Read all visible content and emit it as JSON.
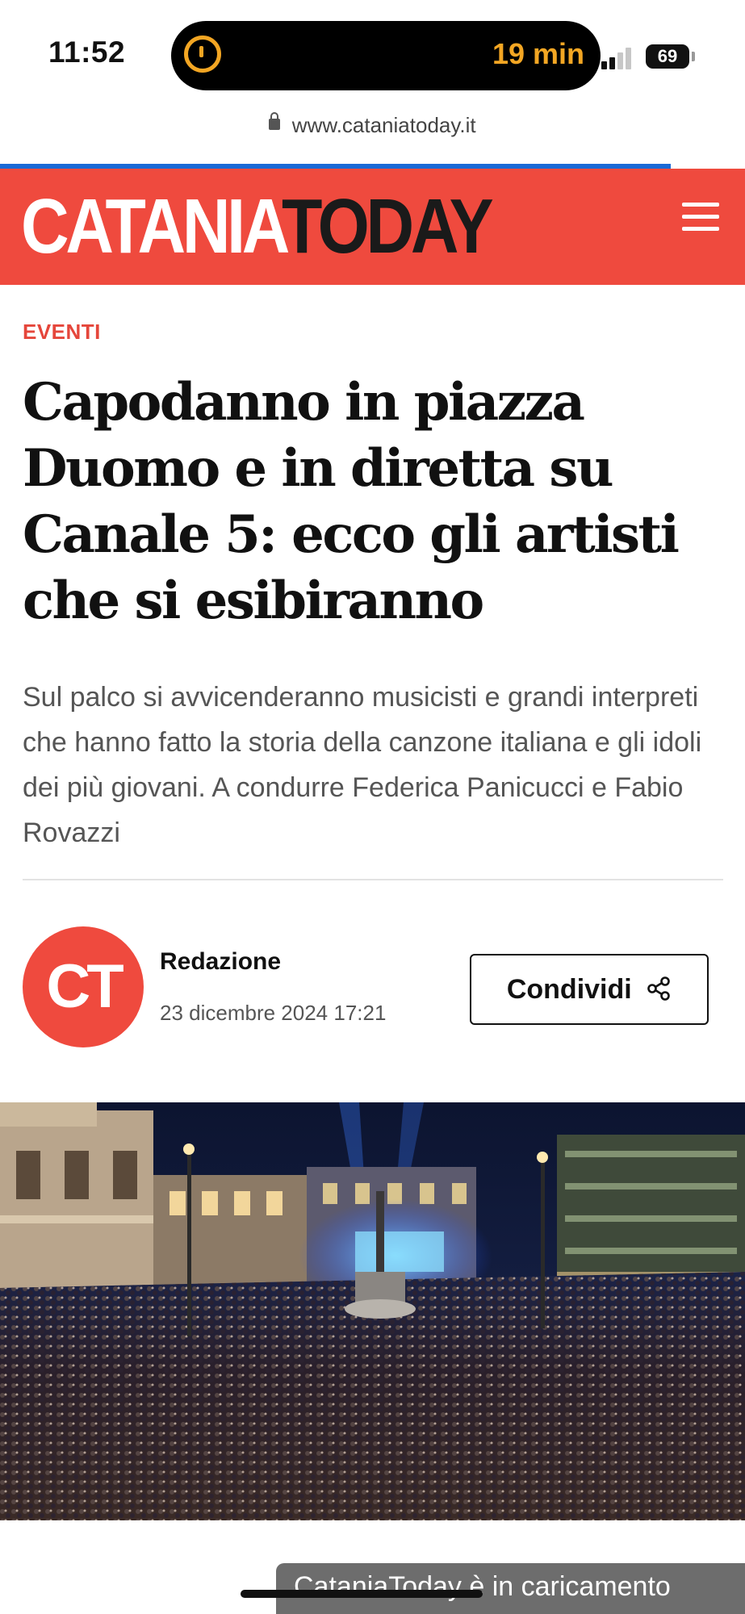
{
  "status_bar": {
    "time": "11:52",
    "activity_text": "19 min",
    "battery": "69"
  },
  "browser": {
    "url": "www.cataniatoday.it",
    "load_progress": 0.9
  },
  "site": {
    "logo_part1": "CATANIA",
    "logo_part2": "TODAY",
    "brand_color": "#ef4a3e"
  },
  "article": {
    "category": "EVENTI",
    "headline": "Capodanno in piazza Duomo e in diretta su Canale 5: ecco gli artisti che si esibiranno",
    "summary": "Sul palco si avvicenderanno musicisti e grandi interpreti che hanno fatto la storia della canzone italiana e gli idoli dei più giovani. A condurre Federica Panicucci e Fabio Rovazzi",
    "author_initials": "CT",
    "author": "Redazione",
    "date": "23 dicembre 2024 17:21",
    "share_label": "Condividi"
  },
  "toast": {
    "text": "CataniaToday è in caricamento"
  },
  "icons": {
    "timer": "timer-icon",
    "signal": "cellular-signal-icon",
    "battery": "battery-icon",
    "lock": "lock-icon",
    "menu": "hamburger-menu-icon",
    "share": "share-icon"
  }
}
